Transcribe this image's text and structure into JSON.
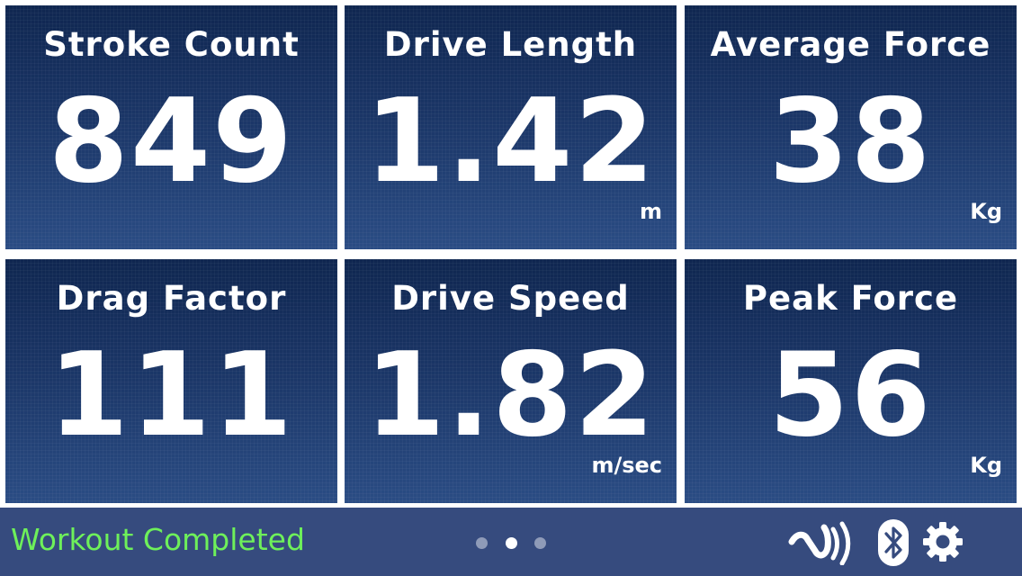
{
  "tiles": [
    {
      "title": "Stroke Count",
      "value": "849",
      "unit": ""
    },
    {
      "title": "Drive Length",
      "value": "1.42",
      "unit": "m"
    },
    {
      "title": "Average Force",
      "value": "38",
      "unit": "Kg"
    },
    {
      "title": "Drag Factor",
      "value": "111",
      "unit": ""
    },
    {
      "title": "Drive Speed",
      "value": "1.82",
      "unit": "m/sec"
    },
    {
      "title": "Peak Force",
      "value": "56",
      "unit": "Kg"
    }
  ],
  "status": {
    "message": "Workout Completed",
    "message_color": "#6ef05a",
    "page_count": 3,
    "active_page": 2
  },
  "icons": [
    "nfc-icon",
    "bluetooth-icon",
    "gear-icon"
  ],
  "colors": {
    "tile_background": "#1d3a6b",
    "status_bar_background": "#364b7e",
    "text": "#ffffff"
  }
}
